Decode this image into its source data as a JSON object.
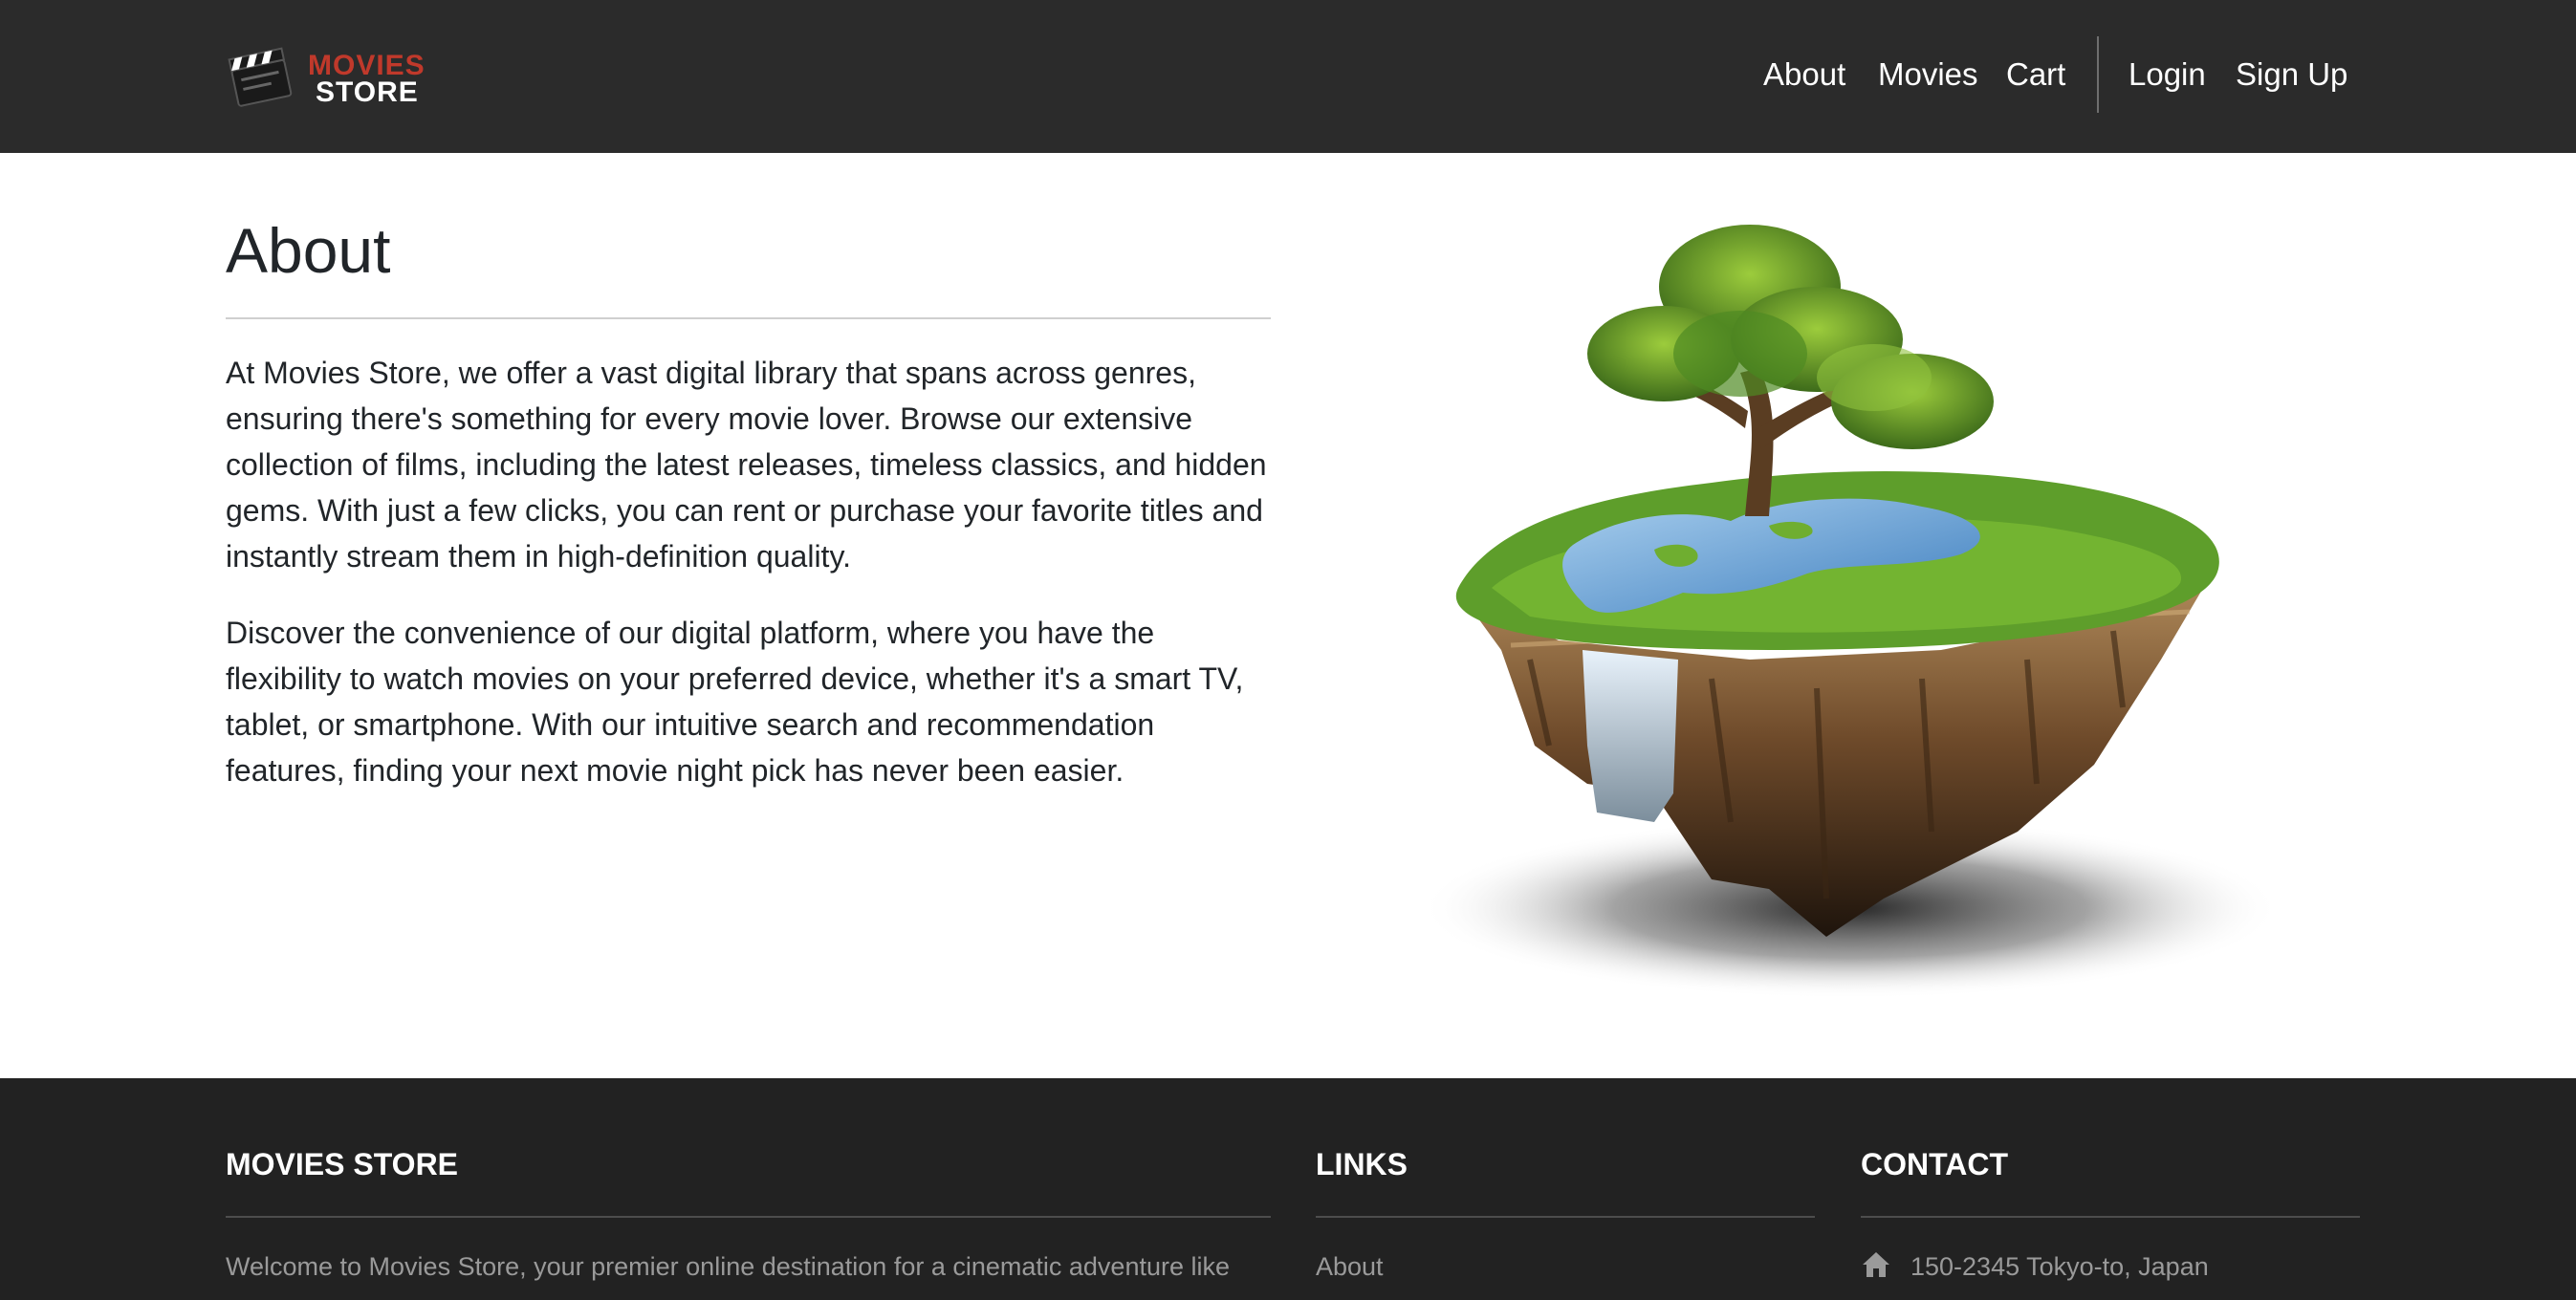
{
  "header": {
    "logo": {
      "line1": "MOVIES",
      "line2": "STORE",
      "icon": "clapperboard-icon"
    },
    "nav": [
      "About",
      "Movies",
      "Cart"
    ],
    "auth": [
      "Login",
      "Sign Up"
    ]
  },
  "main": {
    "title": "About",
    "paragraphs": [
      "At Movies Store, we offer a vast digital library that spans across genres, ensuring there's something for every movie lover. Browse our extensive collection of films, including the latest releases, timeless classics, and hidden gems. With just a few clicks, you can rent or purchase your favorite titles and instantly stream them in high-definition quality.",
      "Discover the convenience of our digital platform, where you have the flexibility to watch movies on your preferred device, whether it's a smart TV, tablet, or smartphone. With our intuitive search and recommendation features, finding your next movie night pick has never been easier."
    ],
    "image": "floating-island-image"
  },
  "footer": {
    "store_title": "MOVIES STORE",
    "store_text": "Welcome to Movies Store, your premier online destination for a cinematic adventure like",
    "links_title": "LINKS",
    "links": [
      "About"
    ],
    "contact_title": "CONTACT",
    "contact_address": "150-2345 Tokyo-to, Japan",
    "contact_icon": "home-icon"
  },
  "colors": {
    "header_bg": "#2b2b2b",
    "footer_bg": "#222222",
    "logo_accent": "#c0392b",
    "text": "#212529",
    "footer_text": "#9a9a9a"
  }
}
